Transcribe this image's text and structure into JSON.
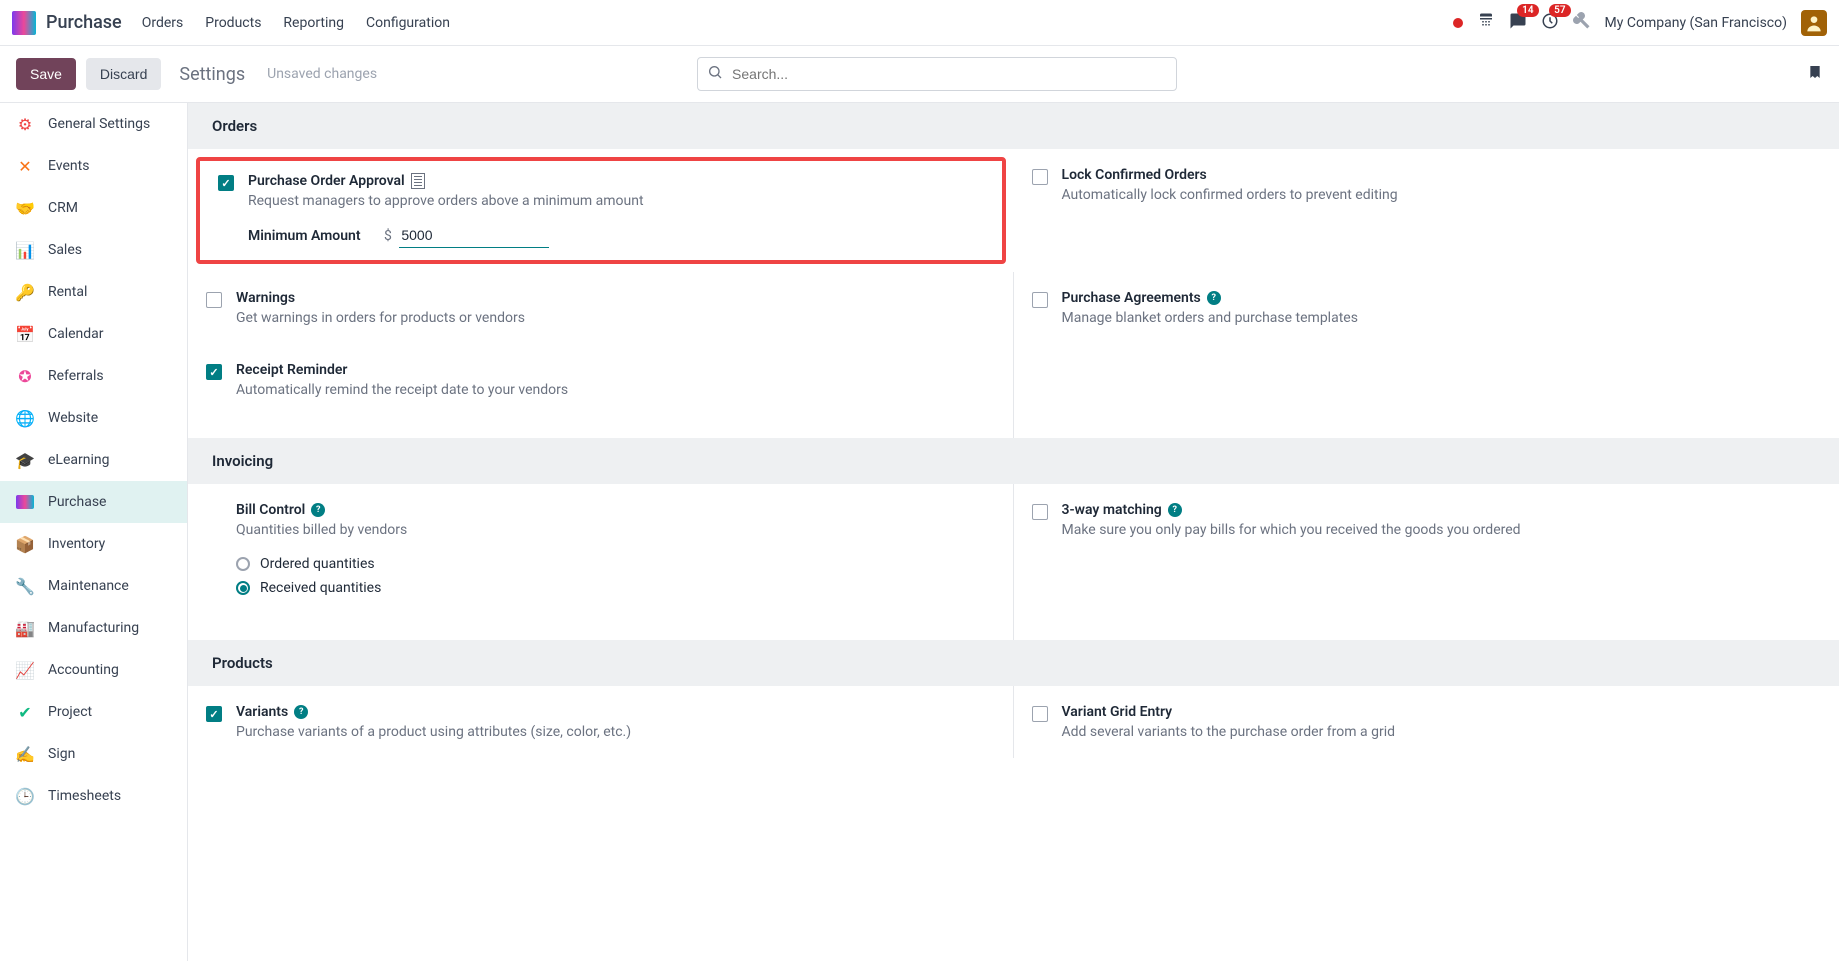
{
  "app": {
    "title": "Purchase"
  },
  "nav": {
    "items": [
      "Orders",
      "Products",
      "Reporting",
      "Configuration"
    ]
  },
  "topright": {
    "discuss_count": "14",
    "activity_count": "57",
    "company": "My Company (San Francisco)"
  },
  "controlbar": {
    "save": "Save",
    "discard": "Discard",
    "title": "Settings",
    "unsaved": "Unsaved changes",
    "search_placeholder": "Search..."
  },
  "sidebar": {
    "items": [
      {
        "label": "General Settings"
      },
      {
        "label": "Events"
      },
      {
        "label": "CRM"
      },
      {
        "label": "Sales"
      },
      {
        "label": "Rental"
      },
      {
        "label": "Calendar"
      },
      {
        "label": "Referrals"
      },
      {
        "label": "Website"
      },
      {
        "label": "eLearning"
      },
      {
        "label": "Purchase"
      },
      {
        "label": "Inventory"
      },
      {
        "label": "Maintenance"
      },
      {
        "label": "Manufacturing"
      },
      {
        "label": "Accounting"
      },
      {
        "label": "Project"
      },
      {
        "label": "Sign"
      },
      {
        "label": "Timesheets"
      }
    ]
  },
  "sections": {
    "orders": {
      "header": "Orders",
      "po_approval": {
        "title": "Purchase Order Approval",
        "desc": "Request managers to approve orders above a minimum amount",
        "min_label": "Minimum Amount",
        "currency": "$",
        "value": "5000"
      },
      "lock": {
        "title": "Lock Confirmed Orders",
        "desc": "Automatically lock confirmed orders to prevent editing"
      },
      "warnings": {
        "title": "Warnings",
        "desc": "Get warnings in orders for products or vendors"
      },
      "agreements": {
        "title": "Purchase Agreements",
        "desc": "Manage blanket orders and purchase templates"
      },
      "receipt": {
        "title": "Receipt Reminder",
        "desc": "Automatically remind the receipt date to your vendors"
      }
    },
    "invoicing": {
      "header": "Invoicing",
      "bill_control": {
        "title": "Bill Control",
        "desc": "Quantities billed by vendors",
        "opt1": "Ordered quantities",
        "opt2": "Received quantities"
      },
      "matching": {
        "title": "3-way matching",
        "desc": "Make sure you only pay bills for which you received the goods you ordered"
      }
    },
    "products": {
      "header": "Products",
      "variants": {
        "title": "Variants",
        "desc": "Purchase variants of a product using attributes (size, color, etc.)"
      },
      "grid": {
        "title": "Variant Grid Entry",
        "desc": "Add several variants to the purchase order from a grid"
      }
    }
  }
}
